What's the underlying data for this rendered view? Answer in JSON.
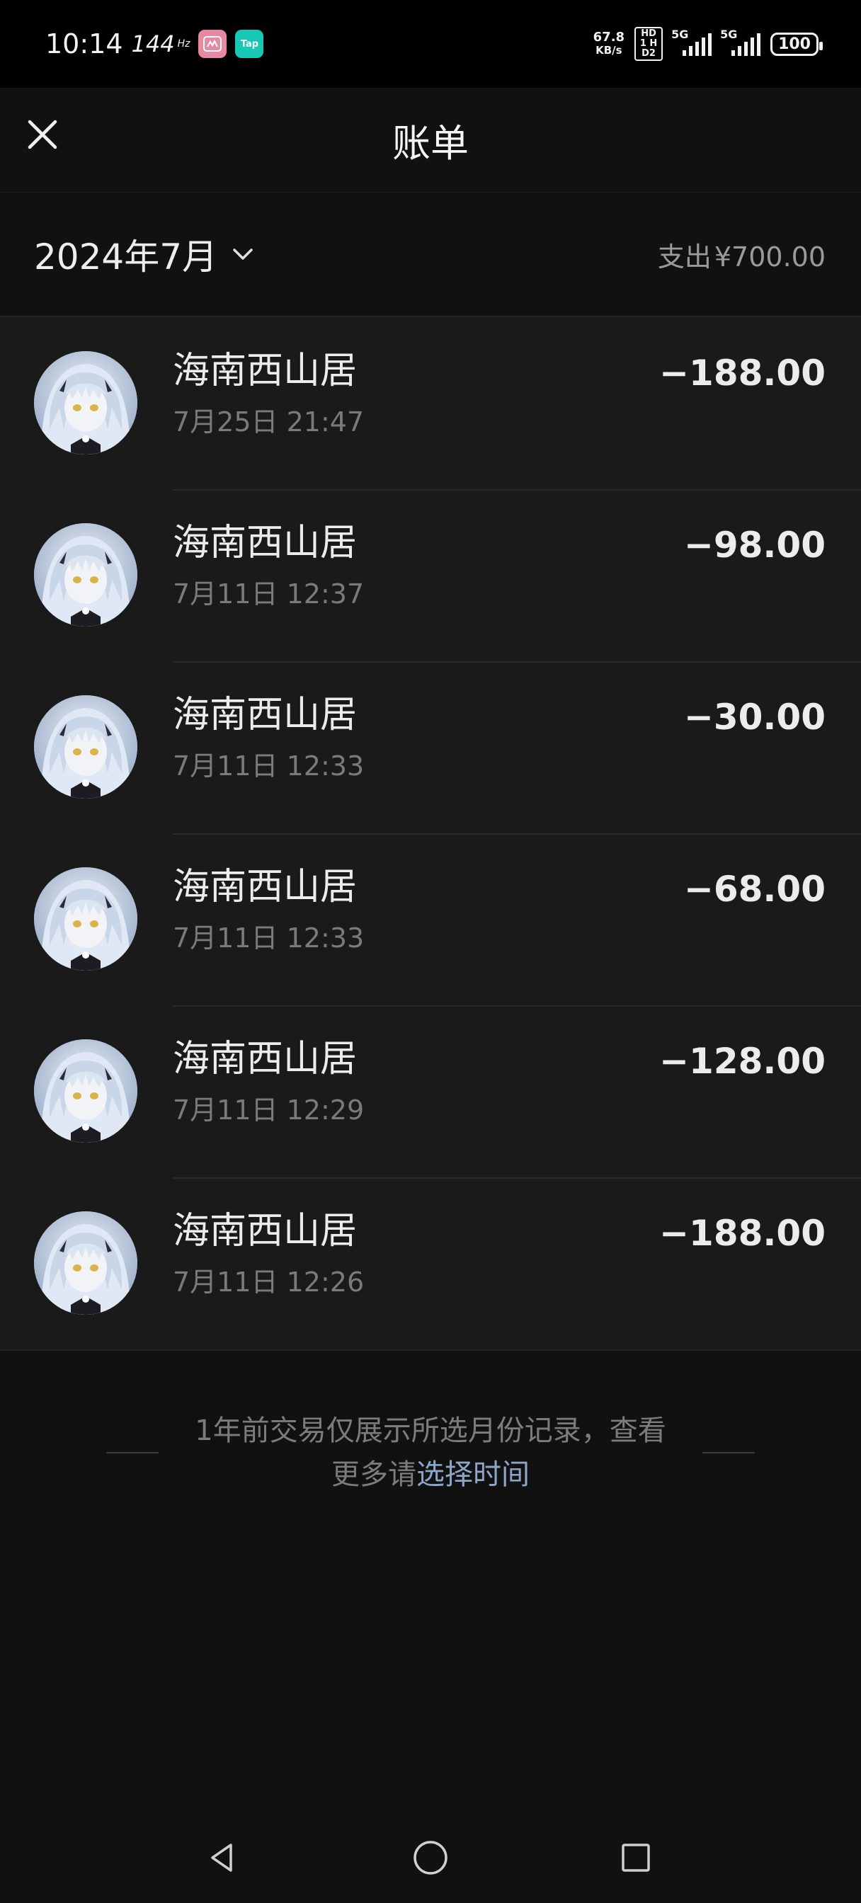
{
  "status_bar": {
    "time": "10:14",
    "refresh_rate": "144",
    "refresh_unit": "Hz",
    "app_badges": [
      "pink-app-icon",
      "Tap"
    ],
    "net_speed_value": "67.8",
    "net_speed_unit": "KB/s",
    "hd_label": "HD1 HD2",
    "sim1_label": "5G",
    "sim2_label": "5G",
    "battery": "100"
  },
  "header": {
    "title": "账单",
    "close_icon": "close-icon"
  },
  "month_bar": {
    "month_label": "2024年7月",
    "expense_label": "支出",
    "expense_amount": "¥700.00"
  },
  "transactions": [
    {
      "merchant": "海南西山居",
      "time": "7月25日 21:47",
      "amount": "−188.00"
    },
    {
      "merchant": "海南西山居",
      "time": "7月11日 12:37",
      "amount": "−98.00"
    },
    {
      "merchant": "海南西山居",
      "time": "7月11日 12:33",
      "amount": "−30.00"
    },
    {
      "merchant": "海南西山居",
      "time": "7月11日 12:33",
      "amount": "−68.00"
    },
    {
      "merchant": "海南西山居",
      "time": "7月11日 12:29",
      "amount": "−128.00"
    },
    {
      "merchant": "海南西山居",
      "time": "7月11日 12:26",
      "amount": "−188.00"
    }
  ],
  "footer_note": {
    "text": "1年前交易仅展示所选月份记录，查看更多请",
    "link": "选择时间"
  },
  "nav": {
    "back_icon": "back-triangle-icon",
    "home_icon": "home-circle-icon",
    "recents_icon": "recents-square-icon"
  },
  "colors": {
    "background": "#111111",
    "list_background": "#1a1a1a",
    "link": "#8da6c7",
    "muted_text": "#7a7a7a"
  }
}
